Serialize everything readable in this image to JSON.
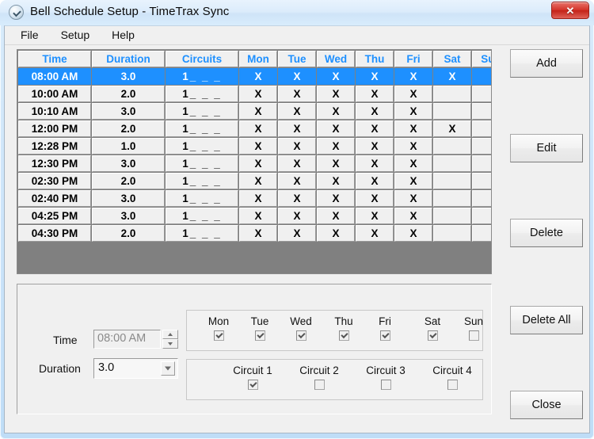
{
  "window": {
    "title": "Bell Schedule Setup - TimeTrax Sync",
    "icon": "clock-icon",
    "close_label": "✕",
    "accent_blue": "#1e90ff",
    "close_red": "#c32218"
  },
  "menubar": {
    "items": [
      {
        "label": "File"
      },
      {
        "label": "Setup"
      },
      {
        "label": "Help"
      }
    ]
  },
  "grid": {
    "columns": [
      "Time",
      "Duration",
      "Circuits",
      "Mon",
      "Tue",
      "Wed",
      "Thu",
      "Fri",
      "Sat",
      "Sun"
    ],
    "mark": "X",
    "circuit_number": "1",
    "circuit_dashes": "_ _ _",
    "rows": [
      {
        "time": "08:00 AM",
        "duration": "3.0",
        "circuits": "1 _ _ _",
        "selected": true,
        "days": {
          "mon": "X",
          "tue": "X",
          "wed": "X",
          "thu": "X",
          "fri": "X",
          "sat": "X",
          "sun": ""
        }
      },
      {
        "time": "10:00 AM",
        "duration": "2.0",
        "circuits": "1 _ _ _",
        "selected": false,
        "days": {
          "mon": "X",
          "tue": "X",
          "wed": "X",
          "thu": "X",
          "fri": "X",
          "sat": "",
          "sun": ""
        }
      },
      {
        "time": "10:10 AM",
        "duration": "3.0",
        "circuits": "1 _ _ _",
        "selected": false,
        "days": {
          "mon": "X",
          "tue": "X",
          "wed": "X",
          "thu": "X",
          "fri": "X",
          "sat": "",
          "sun": ""
        }
      },
      {
        "time": "12:00 PM",
        "duration": "2.0",
        "circuits": "1 _ _ _",
        "selected": false,
        "days": {
          "mon": "X",
          "tue": "X",
          "wed": "X",
          "thu": "X",
          "fri": "X",
          "sat": "X",
          "sun": ""
        }
      },
      {
        "time": "12:28 PM",
        "duration": "1.0",
        "circuits": "1 _ _ _",
        "selected": false,
        "days": {
          "mon": "X",
          "tue": "X",
          "wed": "X",
          "thu": "X",
          "fri": "X",
          "sat": "",
          "sun": ""
        }
      },
      {
        "time": "12:30 PM",
        "duration": "3.0",
        "circuits": "1 _ _ _",
        "selected": false,
        "days": {
          "mon": "X",
          "tue": "X",
          "wed": "X",
          "thu": "X",
          "fri": "X",
          "sat": "",
          "sun": ""
        }
      },
      {
        "time": "02:30 PM",
        "duration": "2.0",
        "circuits": "1 _ _ _",
        "selected": false,
        "days": {
          "mon": "X",
          "tue": "X",
          "wed": "X",
          "thu": "X",
          "fri": "X",
          "sat": "",
          "sun": ""
        }
      },
      {
        "time": "02:40 PM",
        "duration": "3.0",
        "circuits": "1 _ _ _",
        "selected": false,
        "days": {
          "mon": "X",
          "tue": "X",
          "wed": "X",
          "thu": "X",
          "fri": "X",
          "sat": "",
          "sun": ""
        }
      },
      {
        "time": "04:25 PM",
        "duration": "3.0",
        "circuits": "1 _ _ _",
        "selected": false,
        "days": {
          "mon": "X",
          "tue": "X",
          "wed": "X",
          "thu": "X",
          "fri": "X",
          "sat": "",
          "sun": ""
        }
      },
      {
        "time": "04:30 PM",
        "duration": "2.0",
        "circuits": "1 _ _ _",
        "selected": false,
        "days": {
          "mon": "X",
          "tue": "X",
          "wed": "X",
          "thu": "X",
          "fri": "X",
          "sat": "",
          "sun": ""
        }
      }
    ]
  },
  "detail": {
    "time_label": "Time",
    "time_value": "08:00 AM",
    "duration_label": "Duration",
    "duration_value": "3.0",
    "days": [
      {
        "label": "Mon",
        "checked": true
      },
      {
        "label": "Tue",
        "checked": true
      },
      {
        "label": "Wed",
        "checked": true
      },
      {
        "label": "Thu",
        "checked": true
      },
      {
        "label": "Fri",
        "checked": true
      },
      {
        "label": "Sat",
        "checked": true
      },
      {
        "label": "Sun",
        "checked": false
      }
    ],
    "circuits": [
      {
        "label": "Circuit 1",
        "checked": true
      },
      {
        "label": "Circuit 2",
        "checked": false
      },
      {
        "label": "Circuit 3",
        "checked": false
      },
      {
        "label": "Circuit 4",
        "checked": false
      }
    ]
  },
  "buttons": {
    "add": "Add",
    "edit": "Edit",
    "delete": "Delete",
    "delete_all": "Delete All",
    "close": "Close"
  }
}
